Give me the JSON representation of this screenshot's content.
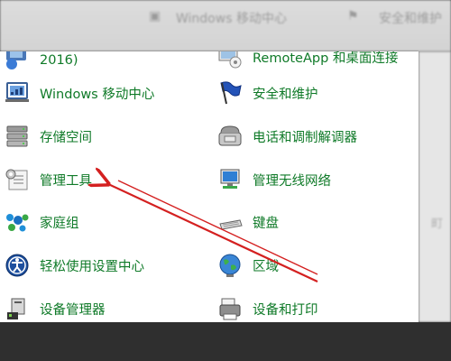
{
  "background": {
    "top_left_text": "Windows 移动中心",
    "top_right_text": "安全和维护",
    "right_edge_text": "町"
  },
  "panel": {
    "left_column": [
      {
        "label": "2016)",
        "icon": "partial-icon"
      },
      {
        "label": "Windows 移动中心",
        "icon": "mobility-center-icon"
      },
      {
        "label": "存储空间",
        "icon": "storage-spaces-icon"
      },
      {
        "label": "管理工具",
        "icon": "admin-tools-icon"
      },
      {
        "label": "家庭组",
        "icon": "homegroup-icon"
      },
      {
        "label": "轻松使用设置中心",
        "icon": "ease-of-access-icon"
      },
      {
        "label": "设备管理器",
        "icon": "device-manager-icon"
      }
    ],
    "right_column": [
      {
        "label": "RemoteApp 和桌面连接",
        "icon": "remoteapp-icon"
      },
      {
        "label": "安全和维护",
        "icon": "security-flag-icon"
      },
      {
        "label": "电话和调制解调器",
        "icon": "phone-modem-icon"
      },
      {
        "label": "管理无线网络",
        "icon": "wireless-network-icon"
      },
      {
        "label": "键盘",
        "icon": "keyboard-icon"
      },
      {
        "label": "区域",
        "icon": "region-globe-icon"
      },
      {
        "label": "设备和打印",
        "icon": "devices-printers-icon"
      }
    ]
  },
  "colors": {
    "link_green": "#0f7a28",
    "arrow_red": "#d42020"
  }
}
